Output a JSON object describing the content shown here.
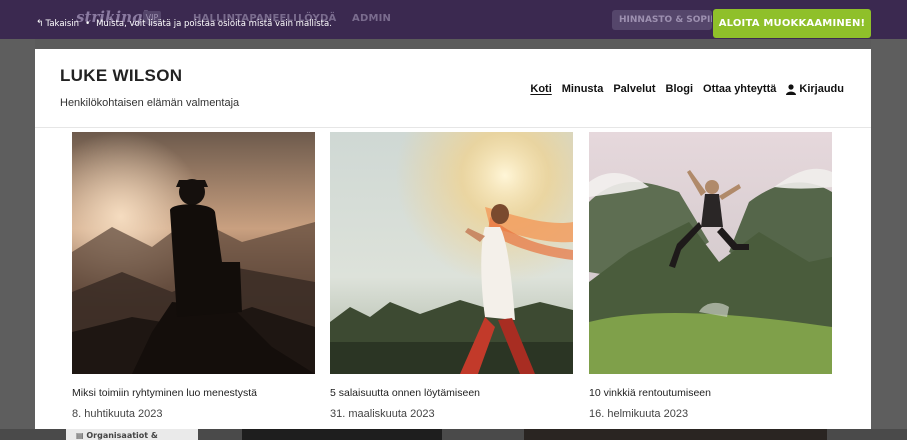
{
  "editor_bar": {
    "logo": "strikingly",
    "logo_badge": "VIP",
    "nav": [
      "HALLINTAPANEELI",
      "LÖYDÄ",
      "ADMIN"
    ],
    "pricing_label": "HINNASTO & SOPIMUKSET",
    "edit_button": "ALOITA MUOKKAAMINEN!",
    "back_label": "Takaisin",
    "notice": "Muista, voit lisätä ja poistaa osioita mistä vain mallista."
  },
  "site": {
    "title": "LUKE WILSON",
    "tagline": "Henkilökohtaisen elämän valmentaja",
    "nav": [
      "Koti",
      "Minusta",
      "Palvelut",
      "Blogi",
      "Ottaa yhteyttä"
    ],
    "login": "Kirjaudu"
  },
  "posts": [
    {
      "title": "Miksi toimiin ryhtyminen luo menestystä",
      "date": "8. huhtikuuta 2023",
      "image": "person-on-mountain-sunset"
    },
    {
      "title": "5 salaisuutta onnen löytämiseen",
      "date": "31. maaliskuuta 2023",
      "image": "woman-running-in-sunlight"
    },
    {
      "title": "10 vinkkiä rentoutumiseen",
      "date": "16. helmikuuta 2023",
      "image": "woman-jumping-in-mountains"
    }
  ],
  "background_peek": {
    "label": "Organisaatiot &"
  },
  "colors": {
    "topbar": "#3b2950",
    "edit_button": "#8fc02a",
    "overlay": "#5e5e5e"
  }
}
